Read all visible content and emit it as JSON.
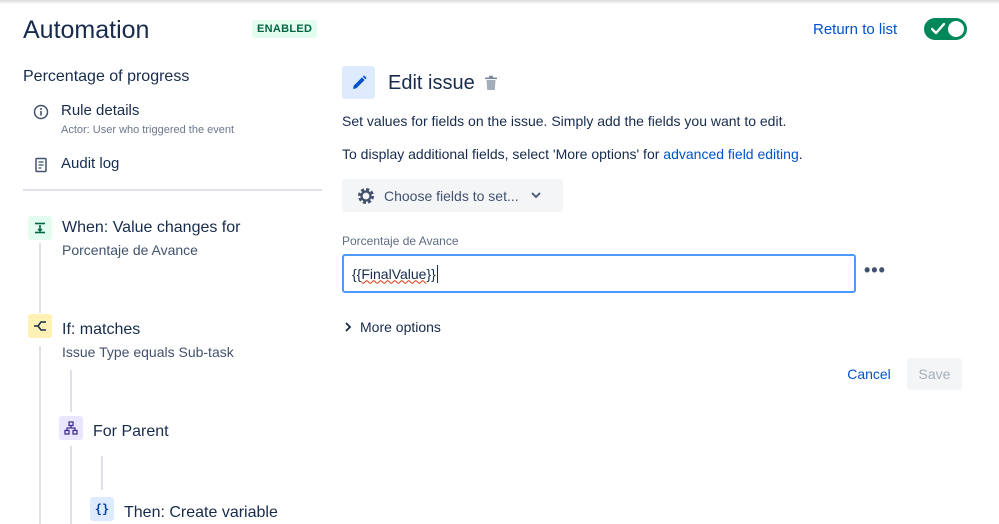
{
  "header": {
    "title": "Automation",
    "status_badge": "ENABLED",
    "return_link": "Return to list",
    "rule_enabled": true
  },
  "sidebar": {
    "rule_name": "Percentage of progress",
    "items": [
      {
        "label": "Rule details",
        "sublabel": "Actor: User who triggered the event",
        "icon": "info-icon"
      },
      {
        "label": "Audit log",
        "icon": "document-icon"
      }
    ],
    "flow": [
      {
        "title": "When: Value changes for",
        "subtitle": "Porcentaje de Avance",
        "icon": "trigger-icon",
        "icon_color": "#E3FCEF",
        "icon_fg": "#006644"
      },
      {
        "title": "If: matches",
        "subtitle": "Issue Type equals Sub-task",
        "icon": "condition-icon",
        "icon_color": "#FFF0B3",
        "icon_fg": "#172B4D"
      },
      {
        "title": "For Parent",
        "icon": "branch-icon",
        "icon_color": "#EAE6FF",
        "icon_fg": "#403294"
      },
      {
        "title": "Then: Create variable",
        "icon": "variable-icon",
        "icon_color": "#DEEBFF",
        "icon_fg": "#0747A6"
      }
    ]
  },
  "panel": {
    "title": "Edit issue",
    "description": "Set values for fields on the issue. Simply add the fields you want to edit.",
    "description2_prefix": "To display additional fields, select 'More options' for ",
    "description2_link": "advanced field editing",
    "description2_suffix": ".",
    "choose_fields_label": "Choose fields to set...",
    "field_label": "Porcentaje de Avance",
    "field_value_prefix": "{{",
    "field_value_word": "FinalValue",
    "field_value_suffix": "}}",
    "more_options_label": "More options",
    "cancel_label": "Cancel",
    "save_label": "Save"
  },
  "colors": {
    "accent": "#0052CC",
    "enabled_green": "#00875A",
    "input_focus": "#4C9AFF"
  }
}
